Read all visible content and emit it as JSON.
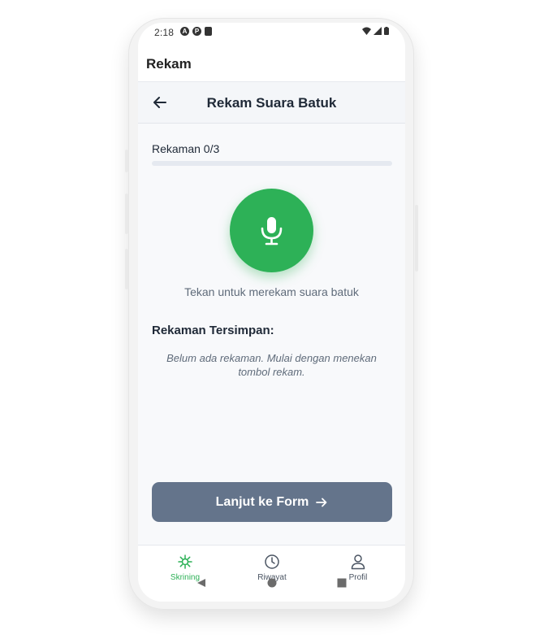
{
  "status_bar": {
    "time": "2:18"
  },
  "appbar": {
    "title": "Rekam"
  },
  "subheader": {
    "title": "Rekam Suara Batuk"
  },
  "progress": {
    "label": "Rekaman 0/3",
    "current": 0,
    "total": 3
  },
  "record": {
    "hint": "Tekan untuk merekam suara batuk"
  },
  "saved": {
    "title": "Rekaman Tersimpan:",
    "empty_message": "Belum ada rekaman. Mulai dengan menekan tombol rekam."
  },
  "next_button": {
    "label": "Lanjut ke Form"
  },
  "bottom_nav": {
    "items": [
      {
        "label": "Skrining",
        "icon": "virus-icon",
        "active": true
      },
      {
        "label": "Riwayat",
        "icon": "clock-icon",
        "active": false
      },
      {
        "label": "Profil",
        "icon": "user-icon",
        "active": false
      }
    ]
  },
  "colors": {
    "accent": "#2db157",
    "button_disabled": "#64748b",
    "text_primary": "#1f2937",
    "text_muted": "#5f6b7a"
  }
}
